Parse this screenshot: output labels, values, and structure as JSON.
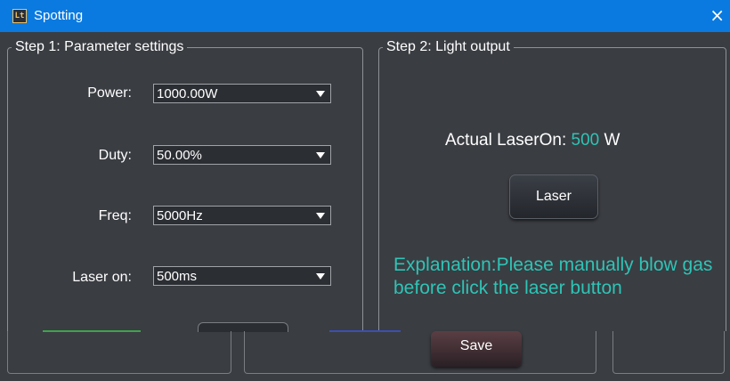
{
  "window": {
    "title": "Spotting",
    "app_icon_glyph": "Lt",
    "close_glyph": "×"
  },
  "step1": {
    "legend": "Step 1: Parameter settings",
    "params": [
      {
        "label": "Power:",
        "value": "1000.00W"
      },
      {
        "label": "Duty:",
        "value": "50.00%"
      },
      {
        "label": "Freq:",
        "value": "5000Hz"
      },
      {
        "label": "Laser on:",
        "value": "500ms"
      }
    ]
  },
  "step2": {
    "legend": "Step 2: Light output",
    "actual_label": "Actual LaserOn:",
    "actual_value": "500",
    "actual_unit": "W",
    "laser_button": "Laser",
    "explanation": "Explanation:Please manually blow gas before click the laser button"
  },
  "footer": {
    "save_button": "Save"
  },
  "colors": {
    "titlebar": "#0a7ae0",
    "background": "#3a3d42",
    "accent_teal": "#2ec4b6"
  }
}
